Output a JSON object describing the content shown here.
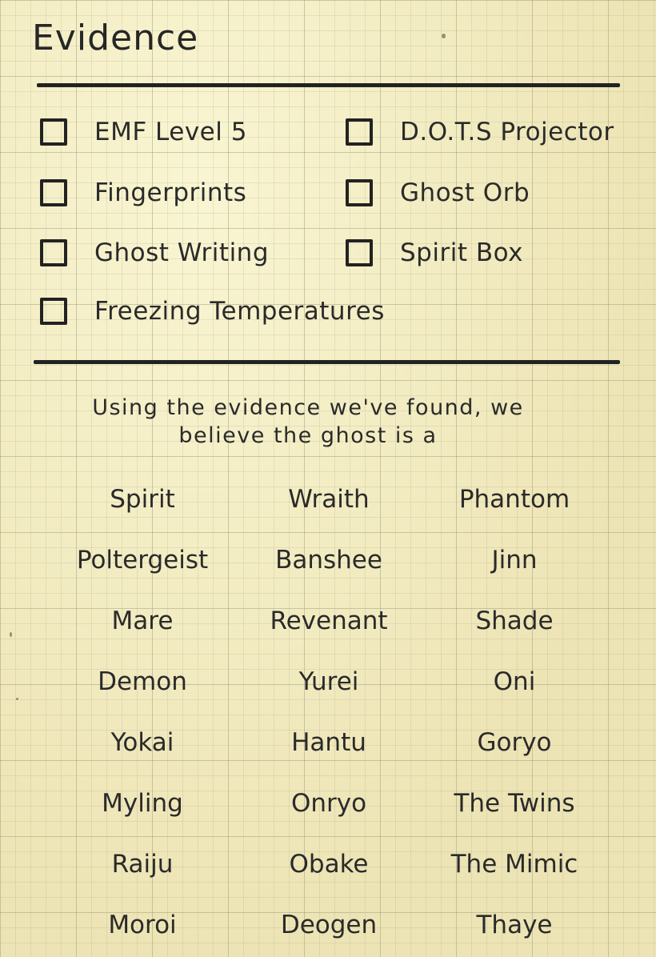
{
  "heading": "Evidence",
  "evidence": [
    "EMF Level 5",
    "D.O.T.S Projector",
    "Fingerprints",
    "Ghost Orb",
    "Ghost Writing",
    "Spirit Box",
    "Freezing Temperatures"
  ],
  "prompt_line1": "Using the evidence we've found, we",
  "prompt_line2": "believe the ghost is a",
  "ghosts": [
    "Spirit",
    "Wraith",
    "Phantom",
    "Poltergeist",
    "Banshee",
    "Jinn",
    "Mare",
    "Revenant",
    "Shade",
    "Demon",
    "Yurei",
    "Oni",
    "Yokai",
    "Hantu",
    "Goryo",
    "Myling",
    "Onryo",
    "The Twins",
    "Raiju",
    "Obake",
    "The Mimic",
    "Moroi",
    "Deogen",
    "Thaye"
  ]
}
